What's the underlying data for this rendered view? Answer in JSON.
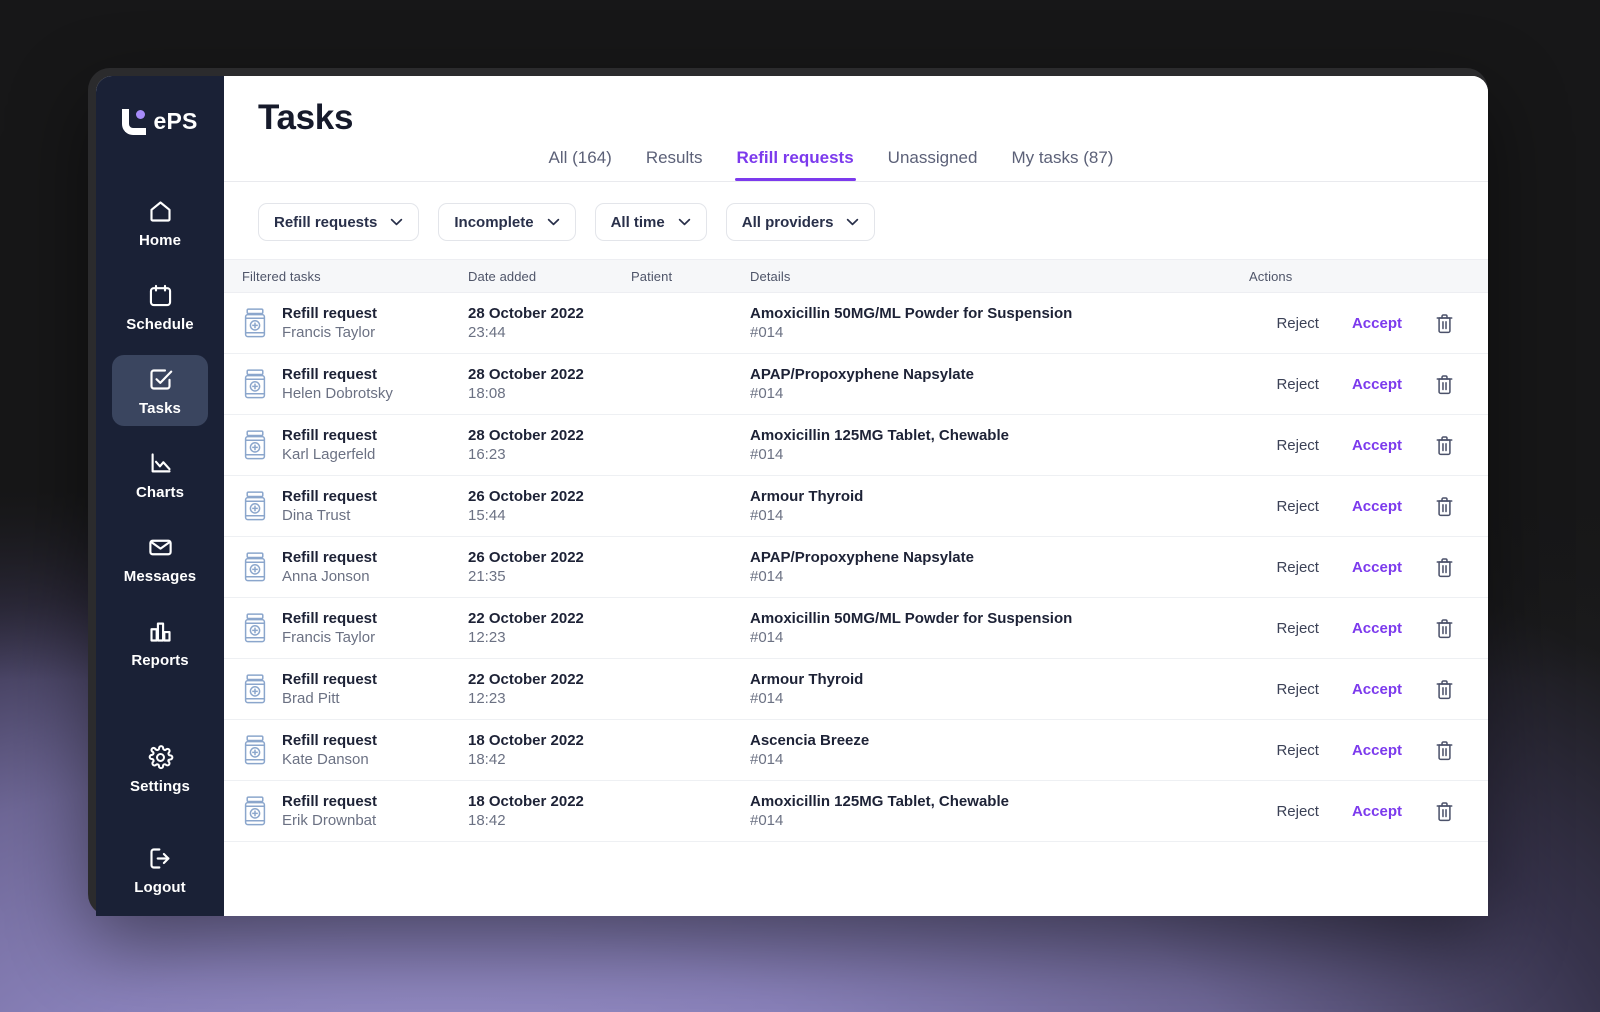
{
  "brand": {
    "logo_text": "ePS",
    "accent": "#7c3aed",
    "sidebar_bg": "#1a2136",
    "logo_dot_color": "#a78bfa"
  },
  "sidebar": {
    "items": [
      {
        "label": "Home",
        "icon": "home-icon",
        "active": false
      },
      {
        "label": "Schedule",
        "icon": "calendar-icon",
        "active": false
      },
      {
        "label": "Tasks",
        "icon": "check-square-icon",
        "active": true
      },
      {
        "label": "Charts",
        "icon": "line-chart-icon",
        "active": false
      },
      {
        "label": "Messages",
        "icon": "envelope-icon",
        "active": false
      },
      {
        "label": "Reports",
        "icon": "bar-chart-icon",
        "active": false
      }
    ],
    "bottom_items": [
      {
        "label": "Settings",
        "icon": "gear-icon"
      },
      {
        "label": "Logout",
        "icon": "logout-icon"
      }
    ]
  },
  "header": {
    "title": "Tasks",
    "tabs": [
      {
        "label": "All (164)",
        "active": false
      },
      {
        "label": "Results",
        "active": false
      },
      {
        "label": "Refill requests",
        "active": true
      },
      {
        "label": "Unassigned",
        "active": false
      },
      {
        "label": "My tasks (87)",
        "active": false
      }
    ]
  },
  "filters": [
    {
      "label": "Refill requests",
      "icon": "chevron-down-icon"
    },
    {
      "label": "Incomplete",
      "icon": "chevron-down-icon"
    },
    {
      "label": "All time",
      "icon": "chevron-down-icon"
    },
    {
      "label": "All providers",
      "icon": "chevron-down-icon"
    }
  ],
  "table": {
    "columns": [
      "Filtered tasks",
      "Date added",
      "Patient",
      "Details",
      "Actions"
    ],
    "actions": {
      "reject": "Reject",
      "accept": "Accept",
      "delete_icon": "trash-icon"
    },
    "rows": [
      {
        "task": "Refill request",
        "patient_name": "Francis Taylor",
        "date": "28 October 2022",
        "time": "23:44",
        "patient": "",
        "detail": "Amoxicillin 50MG/ML Powder for Suspension",
        "detail_id": "#014"
      },
      {
        "task": "Refill request",
        "patient_name": "Helen Dobrotsky",
        "date": "28 October 2022",
        "time": "18:08",
        "patient": "",
        "detail": "APAP/Propoxyphene Napsylate",
        "detail_id": "#014"
      },
      {
        "task": "Refill request",
        "patient_name": "Karl Lagerfeld",
        "date": "28 October 2022",
        "time": "16:23",
        "patient": "",
        "detail": "Amoxicillin 125MG Tablet, Chewable",
        "detail_id": "#014"
      },
      {
        "task": "Refill request",
        "patient_name": "Dina Trust",
        "date": "26 October 2022",
        "time": "15:44",
        "patient": "",
        "detail": "Armour Thyroid",
        "detail_id": "#014"
      },
      {
        "task": "Refill request",
        "patient_name": "Anna Jonson",
        "date": "26 October 2022",
        "time": "21:35",
        "patient": "",
        "detail": "APAP/Propoxyphene Napsylate",
        "detail_id": "#014"
      },
      {
        "task": "Refill request",
        "patient_name": "Francis Taylor",
        "date": "22 October 2022",
        "time": "12:23",
        "patient": "",
        "detail": "Amoxicillin 50MG/ML Powder for Suspension",
        "detail_id": "#014"
      },
      {
        "task": "Refill request",
        "patient_name": "Brad Pitt",
        "date": "22 October 2022",
        "time": "12:23",
        "patient": "",
        "detail": "Armour Thyroid",
        "detail_id": "#014"
      },
      {
        "task": "Refill request",
        "patient_name": "Kate Danson",
        "date": "18 October 2022",
        "time": "18:42",
        "patient": "",
        "detail": "Ascencia Breeze",
        "detail_id": "#014"
      },
      {
        "task": "Refill request",
        "patient_name": "Erik Drownbat",
        "date": "18 October 2022",
        "time": "18:42",
        "patient": "",
        "detail": "Amoxicillin 125MG Tablet, Chewable",
        "detail_id": "#014"
      }
    ]
  }
}
